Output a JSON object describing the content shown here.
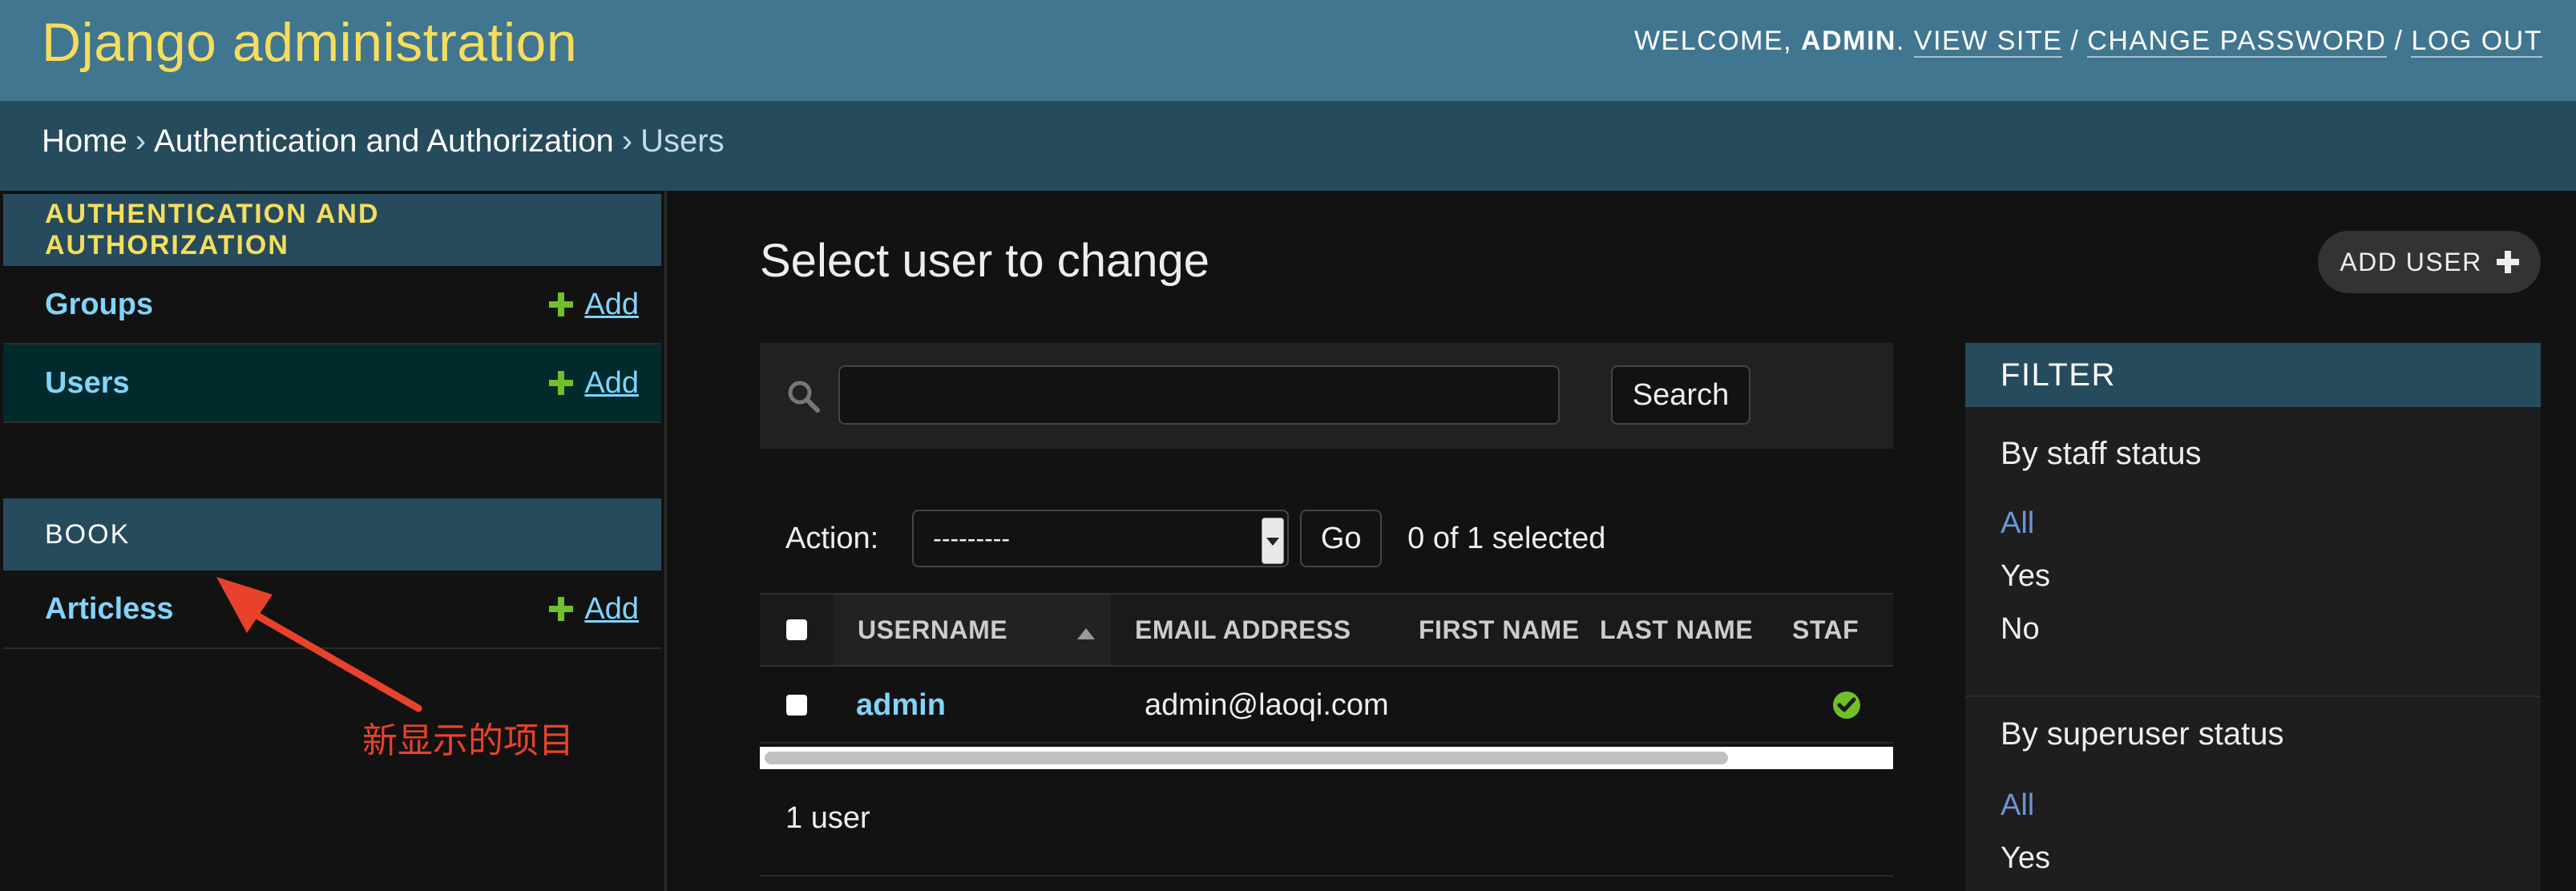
{
  "header": {
    "brand": "Django administration",
    "welcome": "WELCOME,",
    "username": "ADMIN",
    "view_site": "VIEW SITE",
    "change_password": "CHANGE PASSWORD",
    "log_out": "LOG OUT"
  },
  "breadcrumbs": {
    "home": "Home",
    "app": "Authentication and Authorization",
    "current": "Users",
    "separator": "›"
  },
  "sidebar": {
    "auth_caption": "AUTHENTICATION AND AUTHORIZATION",
    "auth_items": [
      {
        "label": "Groups",
        "add": "Add"
      },
      {
        "label": "Users",
        "add": "Add"
      }
    ],
    "book_caption": "BOOK",
    "book_items": [
      {
        "label": "Articless",
        "add": "Add"
      }
    ]
  },
  "annotation": {
    "text": "新显示的项目",
    "color": "#e8422b"
  },
  "main": {
    "title": "Select user to change",
    "add_user": "ADD USER",
    "search": {
      "value": "",
      "button": "Search"
    },
    "actions": {
      "label": "Action:",
      "selected_option": "---------",
      "go": "Go",
      "selection_count": "0 of 1 selected"
    },
    "table": {
      "columns": [
        "USERNAME",
        "EMAIL ADDRESS",
        "FIRST NAME",
        "LAST NAME",
        "STAF"
      ],
      "rows": [
        {
          "username": "admin",
          "email": "admin@laoqi.com",
          "first_name": "",
          "last_name": "",
          "staff": true
        }
      ]
    },
    "paginator": "1 user"
  },
  "filter": {
    "title": "FILTER",
    "groups": [
      {
        "heading": "By staff status",
        "options": [
          "All",
          "Yes",
          "No"
        ],
        "selected": "All"
      },
      {
        "heading": "By superuser status",
        "options": [
          "All",
          "Yes"
        ],
        "selected": "All"
      }
    ]
  },
  "colors": {
    "header_bg": "#417690",
    "breadcrumb_bg": "#264b5d",
    "brand_yellow": "#f5dd5d",
    "link_blue": "#81d4fa",
    "add_green": "#70bf2b"
  }
}
